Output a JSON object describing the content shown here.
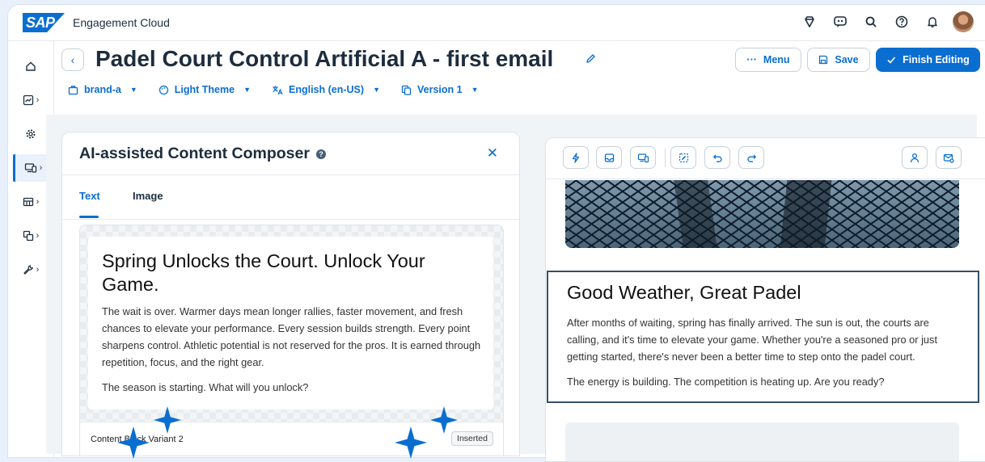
{
  "app": {
    "logo_text": "SAP",
    "name": "Engagement Cloud"
  },
  "shell": {
    "icons": [
      "diamond-icon",
      "chat-bot-icon",
      "search-icon",
      "help-icon",
      "bell-icon",
      "avatar"
    ]
  },
  "rail": {
    "items": [
      "home-icon",
      "analytics-icon",
      "settings-gear-icon",
      "devices-icon",
      "table-icon",
      "layers-icon",
      "wrench-icon"
    ],
    "active_index": 3
  },
  "header": {
    "title": "Padel Court Control Artificial A - first email",
    "menu_label": "Menu",
    "save_label": "Save",
    "finish_label": "Finish Editing"
  },
  "subbar": {
    "brand": "brand-a",
    "theme": "Light Theme",
    "language": "English (en-US)",
    "version": "Version 1"
  },
  "composer": {
    "title": "AI-assisted Content Composer",
    "tabs": [
      "Text",
      "Image"
    ],
    "active_tab": "Text",
    "variant": {
      "headline": "Spring Unlocks the Court. Unlock Your Game.",
      "paragraph1": "The wait is over. Warmer days mean longer rallies, faster movement, and fresh chances to elevate your performance. Every session builds strength. Every point sharpens control. Athletic potential is not reserved for the pros. It is earned through repetition, focus, and the right gear.",
      "paragraph2": "The season is starting. What will you unlock?",
      "label": "Content Block Variant 2",
      "badge": "Inserted"
    }
  },
  "preview": {
    "toolbar_icons": [
      "lightning-icon",
      "inbox-icon",
      "devices-icon",
      "ai-edit-icon",
      "undo-icon",
      "redo-icon",
      "person-icon",
      "mail-settings-icon"
    ],
    "block": {
      "headline": "Good Weather, Great Padel",
      "paragraph1": "After months of waiting, spring has finally arrived. The sun is out, the courts are calling, and it's time to elevate your game. Whether you're a seasoned pro or just getting started, there's never been a better time to step onto the padel court.",
      "paragraph2": "The energy is building. The competition is heating up. Are you ready?"
    }
  },
  "colors": {
    "accent": "#0a6ed1",
    "text": "#1d2d3e",
    "selection_border": "#36506a"
  }
}
